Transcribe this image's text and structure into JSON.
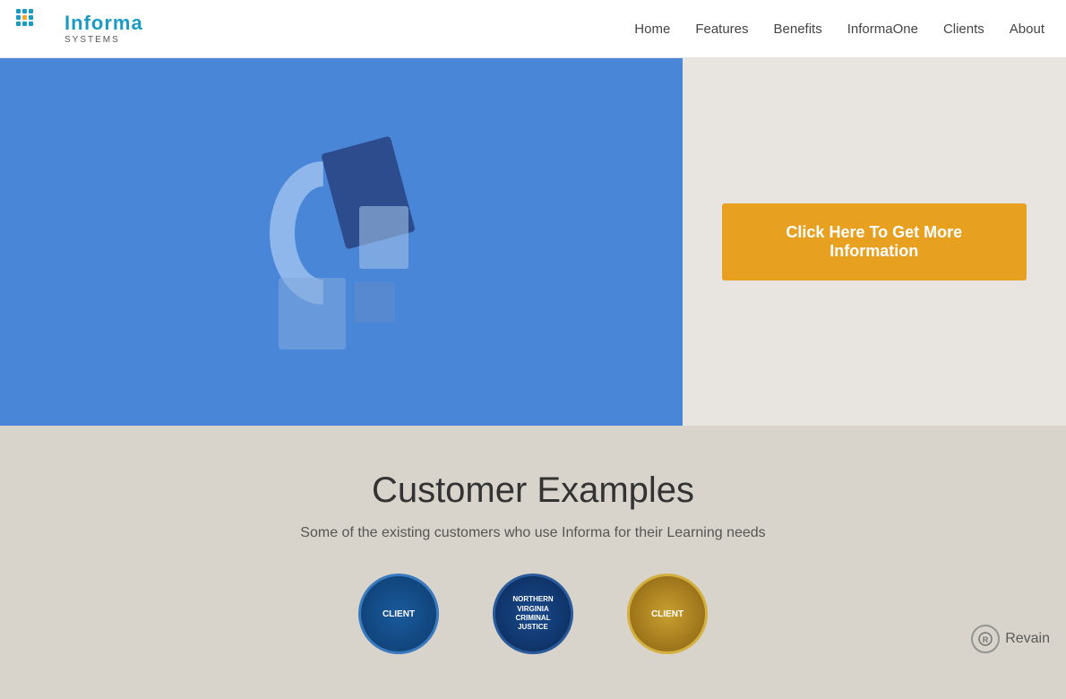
{
  "header": {
    "logo": {
      "brand": "Informa",
      "subtitle": "SYSTEMS"
    },
    "nav": {
      "items": [
        {
          "label": "Home",
          "id": "home"
        },
        {
          "label": "Features",
          "id": "features"
        },
        {
          "label": "Benefits",
          "id": "benefits"
        },
        {
          "label": "InformaOne",
          "id": "informaone"
        },
        {
          "label": "Clients",
          "id": "clients"
        },
        {
          "label": "About",
          "id": "about"
        }
      ]
    }
  },
  "hero": {
    "cta_button_label": "Click Here To Get More Information"
  },
  "customer_section": {
    "heading": "Customer Examples",
    "subheading": "Some of the existing customers who use Informa for their Learning needs"
  },
  "revain": {
    "label": "Revain"
  }
}
